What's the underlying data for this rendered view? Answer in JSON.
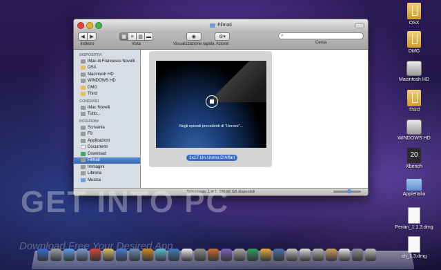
{
  "finder": {
    "window_title": "Filmati",
    "toolbar": {
      "back_label": "Indietro",
      "view_label": "Vista",
      "quicklook_label": "Visualizzazione rapida",
      "action_label": "Azione",
      "search_label": "Cerca",
      "search_value": ""
    },
    "sidebar": {
      "devices_header": "DISPOSITIVI",
      "devices": [
        "iMac di Francesco Novelli",
        "OSX",
        "Macintosh HD",
        "WINDOWS HD",
        "DMG",
        "Third"
      ],
      "shared_header": "CONDIVISI",
      "shared": [
        "iMac Novelli",
        "Tutto..."
      ],
      "places_header": "POSIZIONI",
      "places": [
        "Scrivania",
        "F9",
        "Applicazioni",
        "Documenti",
        "Download",
        "Filmati",
        "Immagini",
        "Libreria",
        "Musica"
      ],
      "selected": "Filmati"
    },
    "preview": {
      "caption": "Negli episodi precedenti di \"Heroes\"...",
      "file_name": "1x17.Un.Uomo.D'Affari"
    },
    "status_text": "Selezionato 1 di 1, 190,66 GB disponibili"
  },
  "desktop_icons": [
    {
      "label": "OSX",
      "kind": "osx"
    },
    {
      "label": "DMG",
      "kind": "osx"
    },
    {
      "label": "Macintosh HD",
      "kind": "drive"
    },
    {
      "label": "Third",
      "kind": "osx"
    },
    {
      "label": "WINDOWS HD",
      "kind": "drive"
    },
    {
      "label": "Xbench",
      "kind": "xbench"
    },
    {
      "label": "AppleItalia",
      "kind": "folder"
    },
    {
      "label": "Perian_1.1.3.dmg",
      "kind": "file"
    },
    {
      "label": "ch_1.3.dmg",
      "kind": "file"
    }
  ],
  "watermark": {
    "title": "GET INTO PC",
    "subtitle": "Download Free Your Desired App"
  },
  "dock_icon_count": 26
}
